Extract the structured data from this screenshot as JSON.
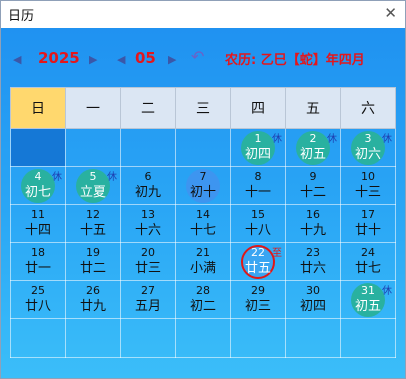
{
  "window": {
    "title": "日历"
  },
  "toolbar": {
    "year": "2025",
    "month": "05",
    "lunar_label": "农历: 乙巳【蛇】年四月"
  },
  "weekdays": [
    "日",
    "一",
    "二",
    "三",
    "四",
    "五",
    "六"
  ],
  "rows": [
    [
      {
        "d": "",
        "l": ""
      },
      {
        "d": "",
        "l": ""
      },
      {
        "d": "",
        "l": ""
      },
      {
        "d": "",
        "l": ""
      },
      {
        "d": "1",
        "l": "初四",
        "b": "休"
      },
      {
        "d": "2",
        "l": "初五",
        "b": "休"
      },
      {
        "d": "3",
        "l": "初六",
        "b": "休"
      }
    ],
    [
      {
        "d": "4",
        "l": "初七",
        "b": "休"
      },
      {
        "d": "5",
        "l": "立夏",
        "b": "休"
      },
      {
        "d": "6",
        "l": "初九"
      },
      {
        "d": "7",
        "l": "初十"
      },
      {
        "d": "8",
        "l": "十一"
      },
      {
        "d": "9",
        "l": "十二"
      },
      {
        "d": "10",
        "l": "十三"
      }
    ],
    [
      {
        "d": "11",
        "l": "十四"
      },
      {
        "d": "12",
        "l": "十五"
      },
      {
        "d": "13",
        "l": "十六"
      },
      {
        "d": "14",
        "l": "十七"
      },
      {
        "d": "15",
        "l": "十八"
      },
      {
        "d": "16",
        "l": "十九"
      },
      {
        "d": "17",
        "l": "廿十"
      }
    ],
    [
      {
        "d": "18",
        "l": "廿一"
      },
      {
        "d": "19",
        "l": "廿二"
      },
      {
        "d": "20",
        "l": "廿三"
      },
      {
        "d": "21",
        "l": "小满"
      },
      {
        "d": "22",
        "l": "廿五",
        "b": "至"
      },
      {
        "d": "23",
        "l": "廿六"
      },
      {
        "d": "24",
        "l": "廿七"
      }
    ],
    [
      {
        "d": "25",
        "l": "廿八"
      },
      {
        "d": "26",
        "l": "廿九"
      },
      {
        "d": "27",
        "l": "五月"
      },
      {
        "d": "28",
        "l": "初二"
      },
      {
        "d": "29",
        "l": "初三"
      },
      {
        "d": "30",
        "l": "初四"
      },
      {
        "d": "31",
        "l": "初五",
        "b": "休"
      }
    ],
    [
      {
        "d": "",
        "l": ""
      },
      {
        "d": "",
        "l": ""
      },
      {
        "d": "",
        "l": ""
      },
      {
        "d": "",
        "l": ""
      },
      {
        "d": "",
        "l": ""
      },
      {
        "d": "",
        "l": ""
      },
      {
        "d": "",
        "l": ""
      }
    ]
  ],
  "colors": {
    "holiday_circle": "#29b1a0",
    "hover_circle": "#3d95f0",
    "today_ring": "#e01818",
    "selected_cell": "#1578d6",
    "sunday_header": "#ffd86e"
  },
  "icons": {
    "close": "close-icon",
    "prev": "triangle-left-icon",
    "next": "triangle-right-icon",
    "undo": "return-arrow-icon"
  }
}
